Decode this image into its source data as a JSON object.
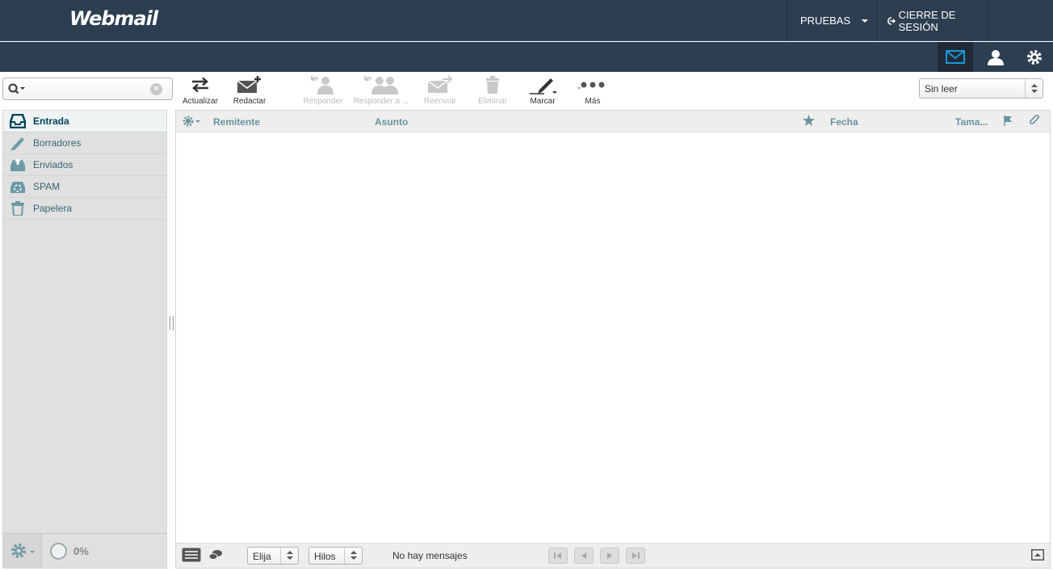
{
  "app": {
    "logo": "Webmail"
  },
  "header": {
    "user_label": "PRUEBAS",
    "logout_label": "CIERRE DE SESIÓN"
  },
  "taskbar": {
    "items": [
      "mail-icon",
      "contacts-icon",
      "settings-icon"
    ]
  },
  "search": {
    "value": "",
    "placeholder": ""
  },
  "toolbar": {
    "refresh": "Actualizar",
    "compose": "Redactar",
    "reply": "Responder",
    "reply_all": "Responder a ...",
    "forward": "Reenviar",
    "delete": "Eliminar",
    "mark": "Marcar",
    "more": "Más"
  },
  "filter": {
    "selected": "Sin leer"
  },
  "folders": [
    {
      "label": "Entrada",
      "icon": "inbox-icon",
      "active": true
    },
    {
      "label": "Borradores",
      "icon": "pencil-icon",
      "active": false
    },
    {
      "label": "Enviados",
      "icon": "sent-icon",
      "active": false
    },
    {
      "label": "SPAM",
      "icon": "spam-icon",
      "active": false
    },
    {
      "label": "Papelera",
      "icon": "trash-icon",
      "active": false
    }
  ],
  "quota": {
    "value": "0%"
  },
  "list": {
    "columns": {
      "sender": "Remitente",
      "subject": "Asunto",
      "date": "Fecha",
      "size": "Tama..."
    }
  },
  "footer": {
    "select_label": "Elija",
    "threads_label": "Hilos",
    "count_text": "No hay mensajes"
  },
  "colors": {
    "header_bg": "#2c3e50",
    "accent": "#1a9ad6",
    "folder_text": "#376572"
  }
}
